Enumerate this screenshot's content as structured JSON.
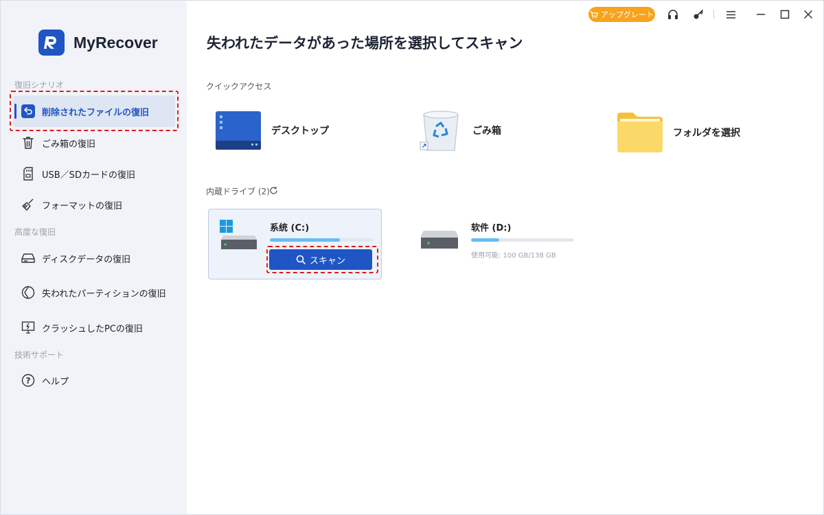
{
  "app": {
    "name": "MyRecover"
  },
  "topbar": {
    "upgrade_label": "アップグレート"
  },
  "sidebar": {
    "sections": [
      {
        "title": "復旧シナリオ"
      },
      {
        "title": "高度な復旧"
      },
      {
        "title": "技術サポート"
      }
    ],
    "items": [
      {
        "label": "削除されたファイルの復旧",
        "icon": "undo-icon",
        "active": true
      },
      {
        "label": "ごみ箱の復旧",
        "icon": "trash-icon"
      },
      {
        "label": "USB／SDカードの復旧",
        "icon": "sd-card-icon"
      },
      {
        "label": "フォーマットの復旧",
        "icon": "broom-icon"
      },
      {
        "label": "ディスクデータの復旧",
        "icon": "disk-icon"
      },
      {
        "label": "失われたパーティションの復旧",
        "icon": "partition-icon"
      },
      {
        "label": "クラッシュしたPCの復旧",
        "icon": "crashed-pc-icon"
      },
      {
        "label": "ヘルプ",
        "icon": "help-icon"
      }
    ]
  },
  "main": {
    "title": "失われたデータがあった場所を選択してスキャン",
    "quick_access": {
      "title": "クイックアクセス",
      "items": [
        {
          "label": "デスクトップ",
          "icon": "desktop-icon"
        },
        {
          "label": "ごみ箱",
          "icon": "recycle-bin-icon"
        },
        {
          "label": "フォルダを選択",
          "icon": "folder-icon"
        }
      ]
    },
    "drives": {
      "title": "内蔵ドライブ (2)",
      "items": [
        {
          "name": "系统 (C:)",
          "used_fraction": 0.68,
          "selected": true
        },
        {
          "name": "软件 (D:)",
          "used_fraction": 0.27,
          "usage_text": "使用可能: 100 GB/138 GB"
        }
      ],
      "scan_label": "スキャン"
    }
  },
  "colors": {
    "accent": "#1f55c4",
    "upgrade": "#f7a31d",
    "highlight": "#e01b1b",
    "progress": "#66bdf4"
  }
}
